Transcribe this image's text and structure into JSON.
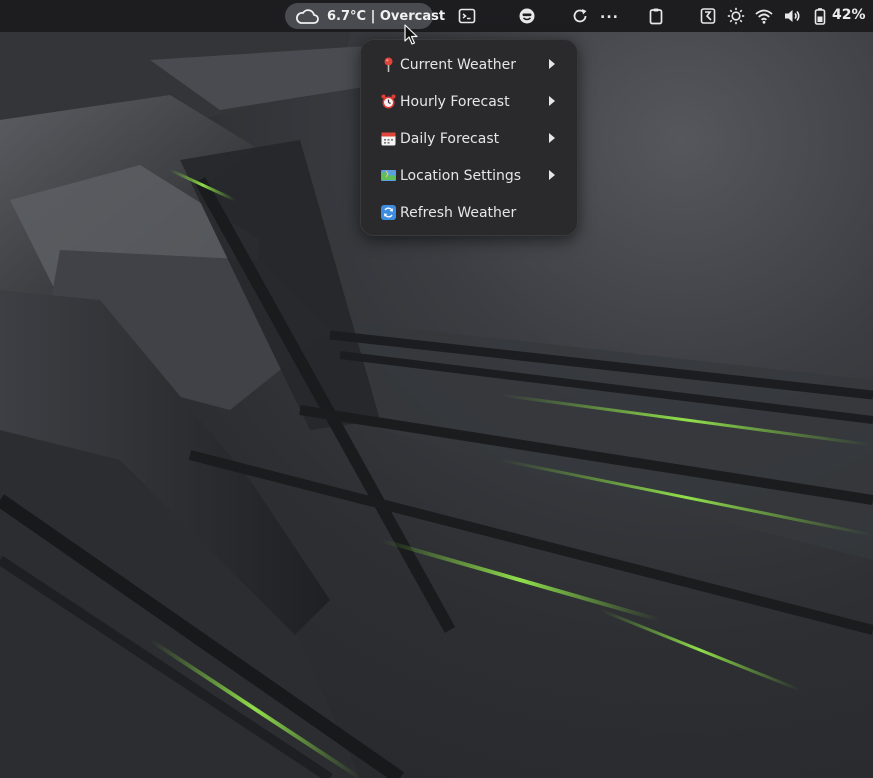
{
  "topbar": {
    "weather": {
      "icon": "cloud-icon",
      "label": "6.7°C | Overcast"
    },
    "tray": [
      {
        "name": "terminal-icon"
      },
      {
        "name": "smiley-icon"
      },
      {
        "name": "refresh-icon"
      },
      {
        "name": "clipboard-icon"
      },
      {
        "name": "input-method-icon"
      },
      {
        "name": "brightness-icon"
      },
      {
        "name": "wifi-icon"
      },
      {
        "name": "volume-icon"
      },
      {
        "name": "battery-icon"
      }
    ],
    "overflow_label": "...",
    "battery_percent": "42%"
  },
  "weather_menu": {
    "items": [
      {
        "emoji": "pin-icon",
        "label": "Current Weather",
        "has_submenu": true
      },
      {
        "emoji": "alarm-clock-icon",
        "label": "Hourly Forecast",
        "has_submenu": true
      },
      {
        "emoji": "calendar-icon",
        "label": "Daily Forecast",
        "has_submenu": true
      },
      {
        "emoji": "map-icon",
        "label": "Location Settings",
        "has_submenu": true
      },
      {
        "emoji": "refresh-arrows-icon",
        "label": "Refresh Weather",
        "has_submenu": false
      }
    ]
  },
  "colors": {
    "topbar_bg": "#1d1d20",
    "pill_bg": "#4a4b50",
    "menu_bg": "#2a2a2c",
    "wallpaper_accent": "#7dd63a"
  }
}
